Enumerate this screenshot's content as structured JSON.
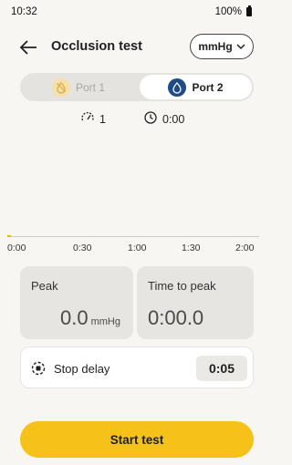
{
  "status_bar": {
    "time": "10:32",
    "battery": "100%"
  },
  "header": {
    "title": "Occlusion test",
    "unit": "mmHg"
  },
  "ports": [
    {
      "label": "Port 1",
      "selected": false,
      "icon": "drop-off-icon"
    },
    {
      "label": "Port 2",
      "selected": true,
      "icon": "drop-icon"
    }
  ],
  "info": {
    "pump_count": "1",
    "elapsed": "0:00"
  },
  "chart": {
    "ticks": [
      "0:00",
      "0:30",
      "1:00",
      "1:30",
      "2:00"
    ]
  },
  "stats": {
    "peak_label": "Peak",
    "peak_value": "0.0",
    "peak_unit": "mmHg",
    "time_to_peak_label": "Time to peak",
    "time_to_peak_value": "0:00.0"
  },
  "stop_delay": {
    "label": "Stop delay",
    "value": "0:05"
  },
  "actions": {
    "start_label": "Start test"
  },
  "colors": {
    "accent": "#f6c21a",
    "port2": "#1e4a86",
    "port1_disabled": "#f6e0a6"
  }
}
